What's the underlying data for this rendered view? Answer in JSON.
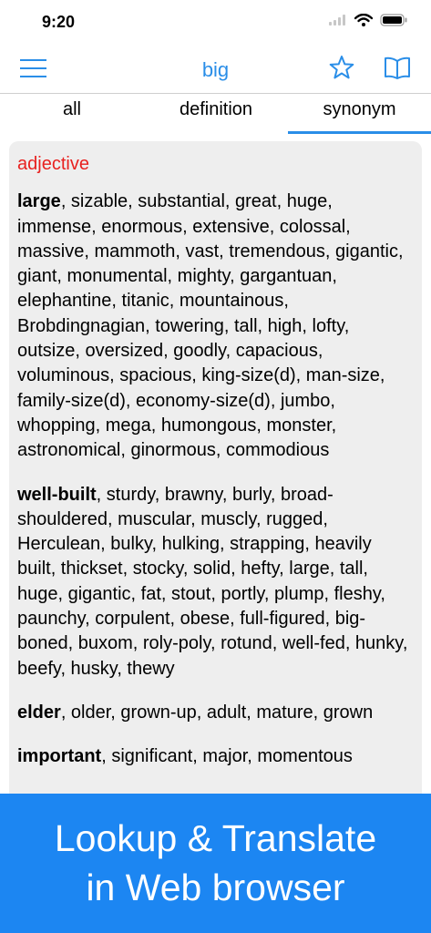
{
  "status": {
    "time": "9:20"
  },
  "nav": {
    "title": "big"
  },
  "tabs": [
    {
      "label": "all"
    },
    {
      "label": "definition"
    },
    {
      "label": "synonym",
      "selected": true
    }
  ],
  "entry": {
    "part_of_speech": "adjective",
    "groups": [
      {
        "head": "large",
        "rest": ", sizable, substantial, great, huge, immense, enormous, extensive, colossal, massive, mammoth, vast, tremendous, gigantic, giant, monumental, mighty, gargantuan, elephantine, titanic, mountainous, Brobdingnagian, towering, tall, high, lofty, outsize, oversized, goodly, capacious, voluminous, spacious, king-size(d), man-size, family-size(d), economy-size(d), jumbo, whopping, mega, humongous, monster, astronomical, ginormous, commodious"
      },
      {
        "head": "well-built",
        "rest": ", sturdy, brawny, burly, broad-shouldered, muscular, muscly, rugged, Herculean, bulky, hulking, strapping, heavily built, thickset, stocky, solid, hefty, large, tall, huge, gigantic, fat, stout, portly, plump, fleshy, paunchy, corpulent, obese, full-figured, big-boned, buxom, roly-poly, rotund, well-fed, hunky, beefy, husky, thewy"
      },
      {
        "head": "elder",
        "rest": ", older, grown-up, adult, mature, grown"
      },
      {
        "head": "important",
        "rest": ", significant, major, momentous"
      }
    ]
  },
  "banner": {
    "line1": "Lookup & Translate",
    "line2": "in Web browser"
  },
  "colors": {
    "accent": "#2a8ee8",
    "pos_label": "#e8211f",
    "banner": "#1c86f2",
    "card": "#eeeeee"
  },
  "icons": [
    "wifi-icon",
    "signal-icon",
    "battery-icon",
    "menu-icon",
    "star-icon",
    "book-icon"
  ]
}
